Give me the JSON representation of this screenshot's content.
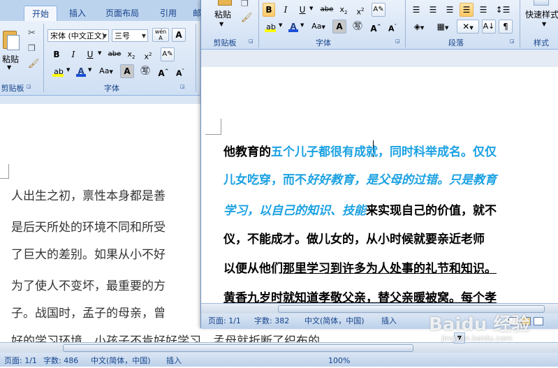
{
  "back_window": {
    "tabs": [
      "开始",
      "插入",
      "页面布局",
      "引用",
      "邮"
    ],
    "clipboard": {
      "paste_label": "粘贴",
      "group_label": "剪贴板"
    },
    "font": {
      "font_name": "宋体 (中文正文)",
      "font_size": "三号",
      "wen_icon": "wén",
      "group_label": "字体"
    },
    "document_lines": [
      "人出生之初，禀性本身都是善",
      "是后天所处的环境不同和所受",
      "了巨大的差别。如果从小不好",
      "为了使人不变坏，最重要的方",
      "子。战国时，孟子的母亲，曾",
      "好的学习环境，小孩子不肯好好学习，孟母就折断了织布的"
    ],
    "status": {
      "page": "页面: 1/1",
      "words": "字数: 486",
      "lang": "中文(简体，中国)",
      "mode": "插入",
      "zoom": "100%"
    }
  },
  "front_window": {
    "clipboard": {
      "paste_label": "粘贴",
      "group_label": "剪贴板"
    },
    "font_group_label": "字体",
    "paragraph_group_label": "段落",
    "styles": {
      "quick_styles_label": "快速样式",
      "group_label": "样式"
    },
    "document_lines": [
      [
        {
          "text": "他教育的",
          "style": "normal"
        },
        {
          "text": "五个儿子都很",
          "style": "blue"
        },
        {
          "text": "有成就，同时科举成名。仅仅",
          "style": "blue"
        }
      ],
      [
        {
          "text": "儿女吃穿，而不",
          "style": "blue"
        },
        {
          "text": "好好教育，是父母的过错。只是教育",
          "style": "blue-italic"
        }
      ],
      [
        {
          "text": "学习，以自己的知识、技能",
          "style": "blue-italic"
        },
        {
          "text": "来",
          "style": "normal"
        },
        {
          "text": "实现自己的价值，就不",
          "style": "normal"
        }
      ],
      [
        {
          "text": "仪，不能成才。做儿女的，从小时候就要亲近老师",
          "style": "normal"
        }
      ],
      [
        {
          "text": "以便从他们",
          "style": "normal"
        },
        {
          "text": "那里学习到许多为人处事的礼节和知识。",
          "style": "underline"
        }
      ],
      [
        {
          "text": "黄香九岁时就知道孝敬父亲，替父亲暖被窝。每个孝",
          "style": "underline"
        }
      ]
    ],
    "status": {
      "page": "页面: 1/1",
      "words": "字数: 382",
      "lang": "中文(简体，中国)",
      "mode": "插入"
    }
  },
  "watermark": {
    "brand": "Baidu 经验",
    "url": "jingyan.baidu.com"
  }
}
